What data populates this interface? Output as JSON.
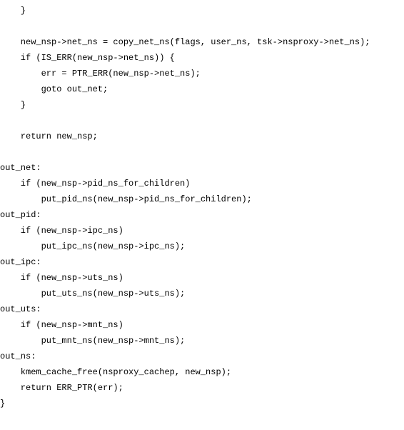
{
  "code": {
    "lines": [
      "    }",
      "",
      "    new_nsp->net_ns = copy_net_ns(flags, user_ns, tsk->nsproxy->net_ns);",
      "    if (IS_ERR(new_nsp->net_ns)) {",
      "        err = PTR_ERR(new_nsp->net_ns);",
      "        goto out_net;",
      "    }",
      "",
      "    return new_nsp;",
      "",
      "out_net:",
      "    if (new_nsp->pid_ns_for_children)",
      "        put_pid_ns(new_nsp->pid_ns_for_children);",
      "out_pid:",
      "    if (new_nsp->ipc_ns)",
      "        put_ipc_ns(new_nsp->ipc_ns);",
      "out_ipc:",
      "    if (new_nsp->uts_ns)",
      "        put_uts_ns(new_nsp->uts_ns);",
      "out_uts:",
      "    if (new_nsp->mnt_ns)",
      "        put_mnt_ns(new_nsp->mnt_ns);",
      "out_ns:",
      "    kmem_cache_free(nsproxy_cachep, new_nsp);",
      "    return ERR_PTR(err);",
      "}"
    ]
  }
}
